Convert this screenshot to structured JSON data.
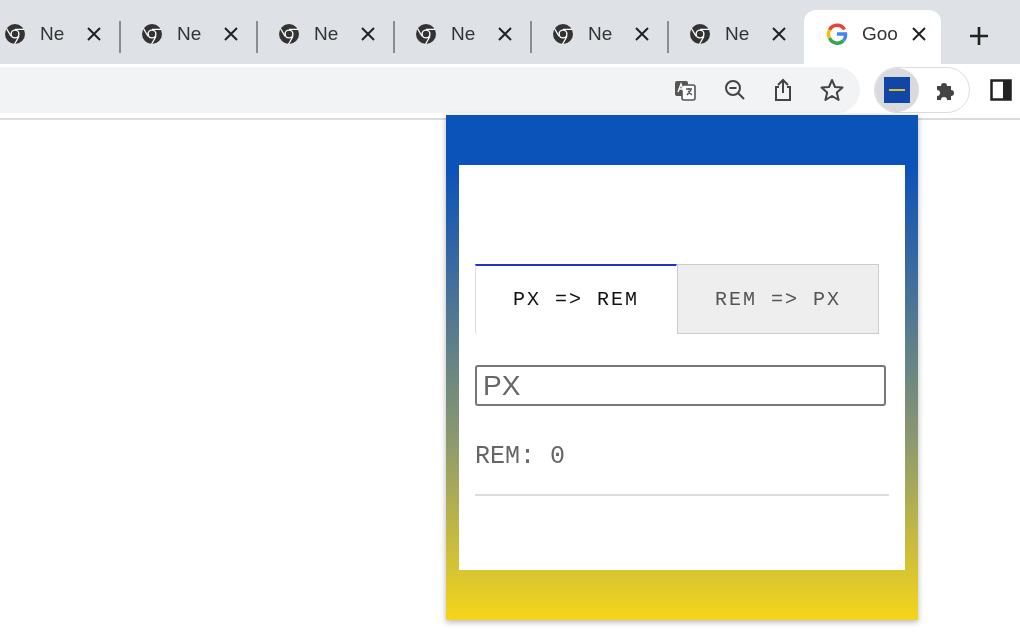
{
  "tabs": [
    {
      "title": "Ne",
      "kind": "chrome",
      "selected": false
    },
    {
      "title": "Ne",
      "kind": "chrome",
      "selected": false
    },
    {
      "title": "Ne",
      "kind": "chrome",
      "selected": false
    },
    {
      "title": "Ne",
      "kind": "chrome",
      "selected": false
    },
    {
      "title": "Ne",
      "kind": "chrome",
      "selected": false
    },
    {
      "title": "Ne",
      "kind": "chrome",
      "selected": false
    },
    {
      "title": "Goo",
      "kind": "google",
      "selected": true
    }
  ],
  "popup": {
    "tabs": [
      {
        "label": "PX => REM",
        "selected": true
      },
      {
        "label": "REM => PX",
        "selected": false
      }
    ],
    "input": {
      "placeholder": "PX"
    },
    "result": "REM: 0"
  }
}
